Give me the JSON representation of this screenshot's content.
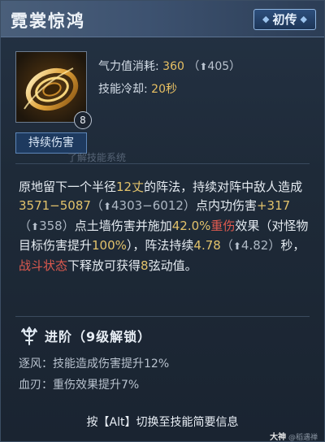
{
  "header": {
    "title": "霓裳惊鸿",
    "tier_badge": "初传"
  },
  "skill": {
    "level": "8",
    "type_tag": "持续伤害",
    "stats": {
      "cost_label": "气力值消耗:",
      "cost_value": "360",
      "cost_delta": "405",
      "cooldown_label": "技能冷却:",
      "cooldown_value": "20秒"
    }
  },
  "background_hint": "了解技能系统",
  "description": {
    "p1": "原地留下一个半径",
    "radius": "12丈",
    "p2": "的阵法，持续对阵中敌人造成",
    "damage_range": "3571−5087",
    "damage_range_delta": "4303−6012",
    "p3": "点内功伤害",
    "bonus": "+317",
    "bonus_delta": "358",
    "p4": "点土墙伤害并施加",
    "heavy_pct": "42.0%",
    "heavy_label": "重伤",
    "p5": "效果（对怪物目标伤害提升",
    "monster_pct": "100%",
    "p6": "），阵法持续",
    "duration": "4.78",
    "duration_delta": "4.82",
    "p7": "秒，",
    "combat_state": "战斗状态",
    "p8": "下释放可获得",
    "string_count": "8",
    "p9": "弦动值。"
  },
  "advance": {
    "title": "进阶（9级解锁）",
    "lines": [
      "逐风：技能造成伤害提升12%",
      "血刃：重伤效果提升7%"
    ]
  },
  "footer": {
    "hint": "按【Alt】切换至技能简要信息"
  },
  "watermark": {
    "brand": "大神",
    "handle": "@稻遇禅"
  },
  "colors": {
    "gold": "#e2c26b",
    "red": "#e05a4f",
    "badge_blue": "#1e3a5f"
  },
  "icons": {
    "skill": "golden-ring-swirl-icon",
    "advance": "trident-icon",
    "arrow": "up-arrow-icon"
  }
}
